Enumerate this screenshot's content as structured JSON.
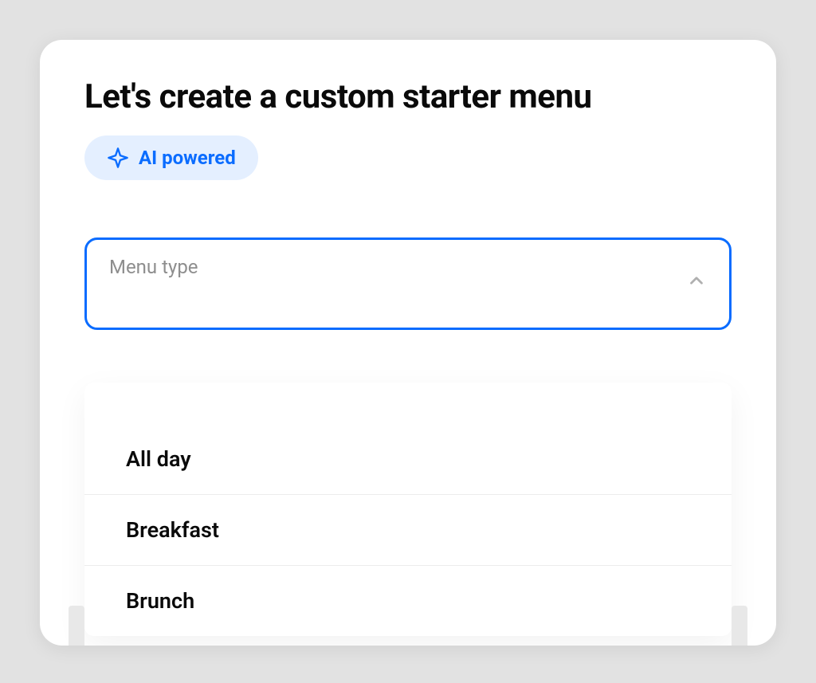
{
  "title": "Let's create a custom starter menu",
  "badge": {
    "label": "AI powered"
  },
  "menu_type": {
    "label": "Menu type",
    "open": true,
    "options": [
      {
        "label": "All day"
      },
      {
        "label": "Breakfast"
      },
      {
        "label": "Brunch"
      }
    ]
  }
}
